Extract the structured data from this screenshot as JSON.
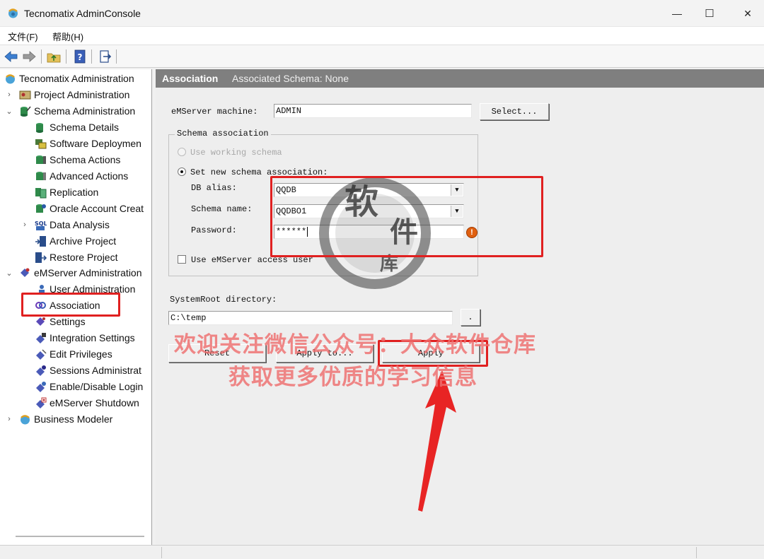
{
  "window": {
    "title": "Tecnomatix AdminConsole",
    "minimize": "—",
    "maximize": "☐",
    "close": "✕"
  },
  "menu": {
    "file": "文件(F)",
    "help": "帮助(H)"
  },
  "toolbar": {
    "icons": [
      "back-arrow-icon",
      "forward-arrow-icon",
      "folder-up-icon",
      "help-book-icon",
      "exit-door-icon"
    ]
  },
  "tree": {
    "root": "Tecnomatix Administration",
    "project_admin": "Project Administration",
    "schema_admin": "Schema Administration",
    "schema_children": [
      "Schema Details",
      "Software Deploymen",
      "Schema Actions",
      "Advanced Actions",
      "Replication",
      "Oracle Account Creat",
      "Data Analysis",
      "Archive Project",
      "Restore Project"
    ],
    "emserver_admin": "eMServer Administration",
    "emserver_children": [
      "User Administration",
      "Association",
      "Settings",
      "Integration Settings",
      "Edit Privileges",
      "Sessions Administrat",
      "Enable/Disable Login",
      "eMServer Shutdown"
    ],
    "business_modeler": "Business Modeler",
    "selected": "Association"
  },
  "panel": {
    "title": "Association",
    "associated_schema": "Associated Schema: None",
    "emserver_label": "eMServer machine:",
    "emserver_value": "ADMIN",
    "select_button": "Select...",
    "schema_group": "Schema association",
    "use_working": "Use working schema",
    "set_new": "Set new schema association:",
    "db_alias_label": "DB alias:",
    "db_alias_value": "QQDB",
    "schema_name_label": "Schema name:",
    "schema_name_value": "QQDBO1",
    "password_label": "Password:",
    "password_value": "******",
    "use_access_user": "Use eMServer access user",
    "sysroot_label": "SystemRoot directory:",
    "sysroot_value": "C:\\temp",
    "browse_button": ".",
    "reset_button": "Reset",
    "apply_to_button": "Apply to...",
    "apply_button": "Apply",
    "selected_radio": "set_new"
  },
  "overlay": {
    "line1": "欢迎关注微信公众号：大众软件仓库",
    "line2": "获取更多优质的学习信息",
    "seal_chars": [
      "软",
      "件",
      "库"
    ],
    "annotation_color": "#e02020"
  },
  "colors": {
    "header_bg": "#7f7f7f",
    "selection_border": "#e02020",
    "watermark_text": "#ee6e6e"
  }
}
